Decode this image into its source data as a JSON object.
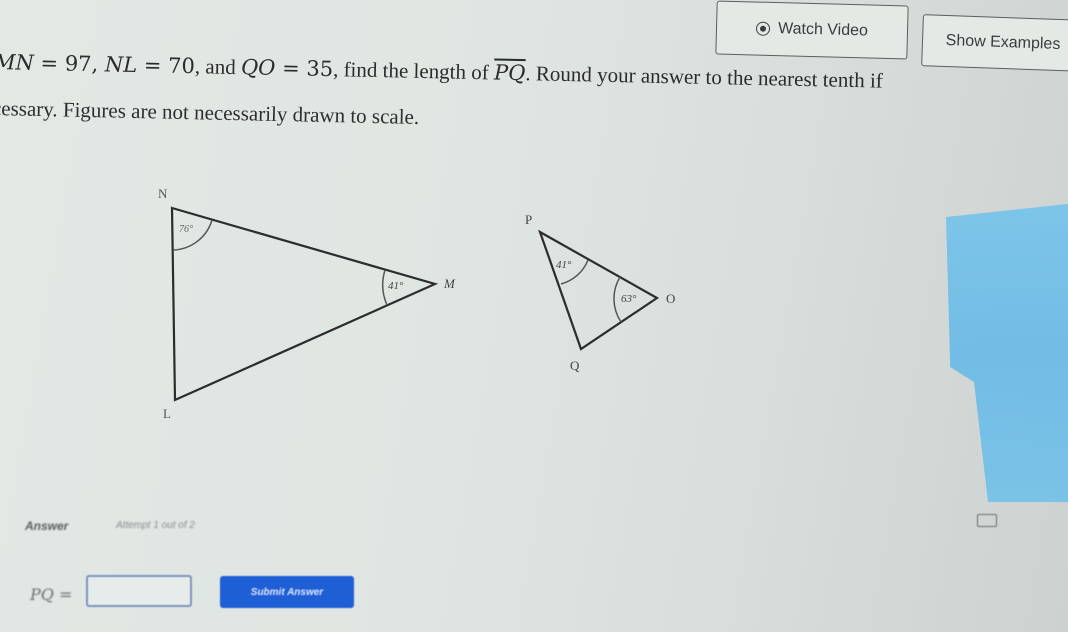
{
  "header": {
    "watch_video_label": "Watch Video",
    "watch_video_icon": "play-circle-icon",
    "show_examples_label": "Show Examples"
  },
  "question": {
    "line1_parts": {
      "mn": "MN",
      "mn_val": "97",
      "nl": "NL",
      "nl_val": "70",
      "and": ", and ",
      "qo": "QO",
      "qo_val": "35",
      "find_text": ", find the length of ",
      "segment": "PQ",
      "round_text": ". Round your answer to the nearest tenth if"
    },
    "line2": "cessary. Figures are not necessarily drawn to scale."
  },
  "figures": {
    "triangle1": {
      "vertices": [
        "N",
        "M",
        "L"
      ],
      "angle_N": "76°",
      "angle_M": "41°"
    },
    "triangle2": {
      "vertices": [
        "P",
        "O",
        "Q"
      ],
      "angle_P": "41°",
      "angle_O": "63°"
    }
  },
  "answer": {
    "label": "Answer",
    "attempt_text": "Attempt 1 out of 2",
    "input_label": "PQ =",
    "input_value": "",
    "submit_label": "Submit Answer"
  }
}
